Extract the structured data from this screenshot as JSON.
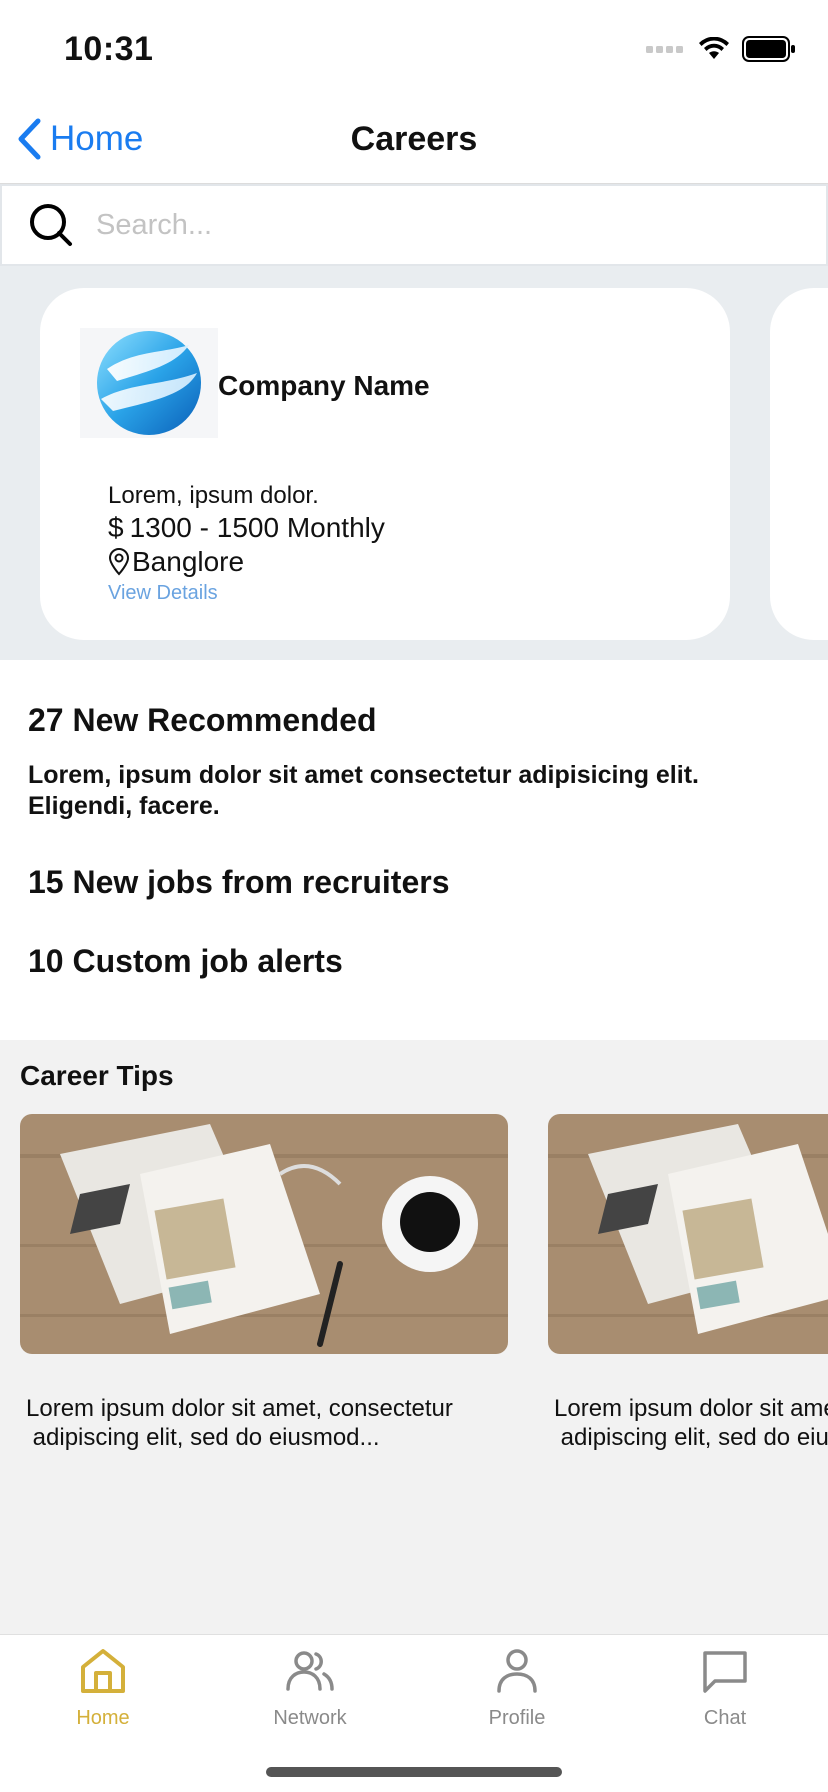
{
  "status_bar": {
    "time": "10:31"
  },
  "nav": {
    "back_label": "Home",
    "title": "Careers"
  },
  "search": {
    "placeholder": "Search..."
  },
  "job_card": {
    "company_name": "Company Name",
    "description": "Lorem, ipsum dolor.",
    "salary": "1300 - 1500 Monthly",
    "currency_symbol": "$",
    "location": "Banglore",
    "view_details": "View Details"
  },
  "stats": {
    "recommended": "27 New Recommended",
    "recommended_text": "Lorem, ipsum dolor sit amet consectetur adipisicing elit. Eligendi, facere.",
    "recruiters": "15 New jobs from recruiters",
    "alerts": "10 Custom job alerts"
  },
  "career_tips": {
    "title": "Career Tips",
    "items": [
      {
        "text": "Lorem ipsum dolor sit amet, consectetur\n adipiscing elit, sed do eiusmod..."
      },
      {
        "text": "Lorem ipsum dolor sit amet, consectetur\n adipiscing elit, sed do eiusmod..."
      }
    ]
  },
  "tabs": [
    {
      "label": "Home",
      "icon": "home-icon",
      "active": true
    },
    {
      "label": "Network",
      "icon": "users-icon",
      "active": false
    },
    {
      "label": "Profile",
      "icon": "user-icon",
      "active": false
    },
    {
      "label": "Chat",
      "icon": "chat-icon",
      "active": false
    }
  ],
  "colors": {
    "accent": "#1a7cf0",
    "active_tab": "#d4b03a",
    "link": "#6aa3e0",
    "carousel_bg": "#e9edf0"
  }
}
